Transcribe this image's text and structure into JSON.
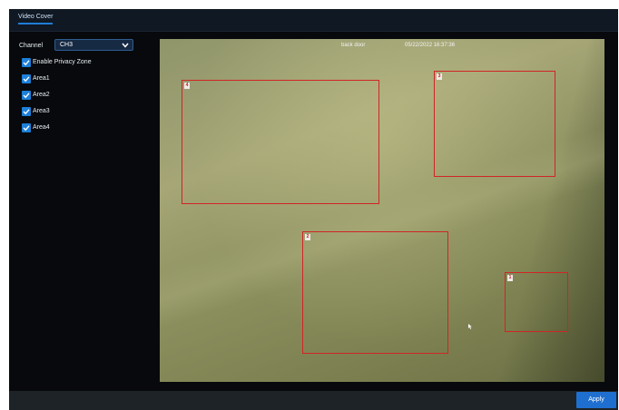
{
  "tabs": [
    {
      "label": "Video Cover"
    }
  ],
  "settings": {
    "channel_label": "Channel",
    "channel_value": "CH3",
    "enable_privacy_zone": {
      "label": "Enable Privacy Zone",
      "checked": true
    },
    "areas": [
      {
        "label": "Area1",
        "checked": true
      },
      {
        "label": "Area2",
        "checked": true
      },
      {
        "label": "Area3",
        "checked": true
      },
      {
        "label": "Area4",
        "checked": true
      }
    ]
  },
  "video": {
    "camera_name": "back door",
    "timestamp": "05/22/2022 16:37:36",
    "zones": [
      "1",
      "2",
      "3",
      "4"
    ]
  },
  "footer": {
    "apply_label": "Apply"
  },
  "colors": {
    "accent": "#1f6fd0",
    "zone_border": "#d02525",
    "panel_bg": "#07090c"
  },
  "icons": [
    "chevron-down-icon",
    "checkbox-checked-icon",
    "mouse-cursor-icon"
  ]
}
